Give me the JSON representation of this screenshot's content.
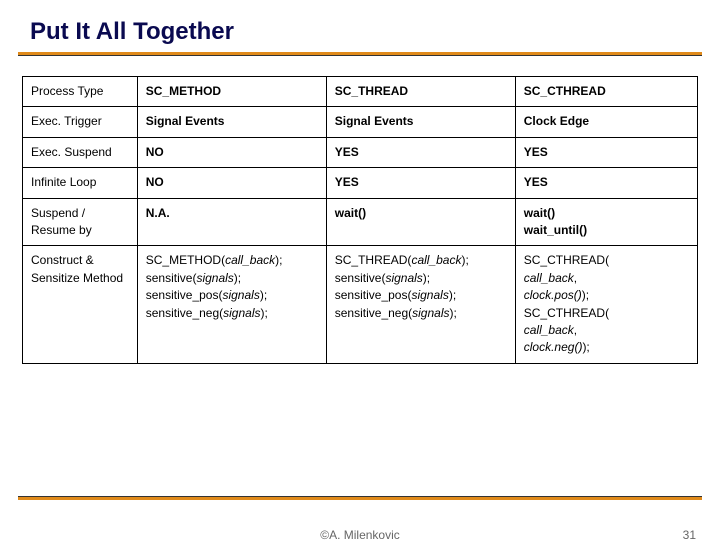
{
  "title": "Put It All Together",
  "table": {
    "header": {
      "label": "Process Type",
      "c1": "SC_METHOD",
      "c2": "SC_THREAD",
      "c3": "SC_CTHREAD"
    },
    "rows": {
      "trigger": {
        "label": "Exec. Trigger",
        "c1": "Signal Events",
        "c2": "Signal Events",
        "c3": "Clock Edge"
      },
      "suspend": {
        "label": "Exec. Suspend",
        "c1": "NO",
        "c2": "YES",
        "c3": "YES"
      },
      "loop": {
        "label": "Infinite Loop",
        "c1": "NO",
        "c2": "YES",
        "c3": "YES"
      },
      "resume": {
        "label": "Suspend / Resume by",
        "c1": "N.A.",
        "c2": "wait()",
        "c3": "wait()\nwait_until()"
      },
      "construct": {
        "label": "Construct & Sensitize Method",
        "c1": "SC_METHOD(call_back);\nsensitive(signals);\nsensitive_pos(signals);\nsensitive_neg(signals);",
        "c2": "SC_THREAD(call_back);\nsensitive(signals);\nsensitive_pos(signals);\nsensitive_neg(signals);",
        "c3": "SC_CTHREAD(\ncall_back,\nclock.pos());\nSC_CTHREAD(\ncall_back,\nclock.neg());"
      }
    }
  },
  "footer": {
    "author": "©A. Milenkovic",
    "page": "31"
  }
}
